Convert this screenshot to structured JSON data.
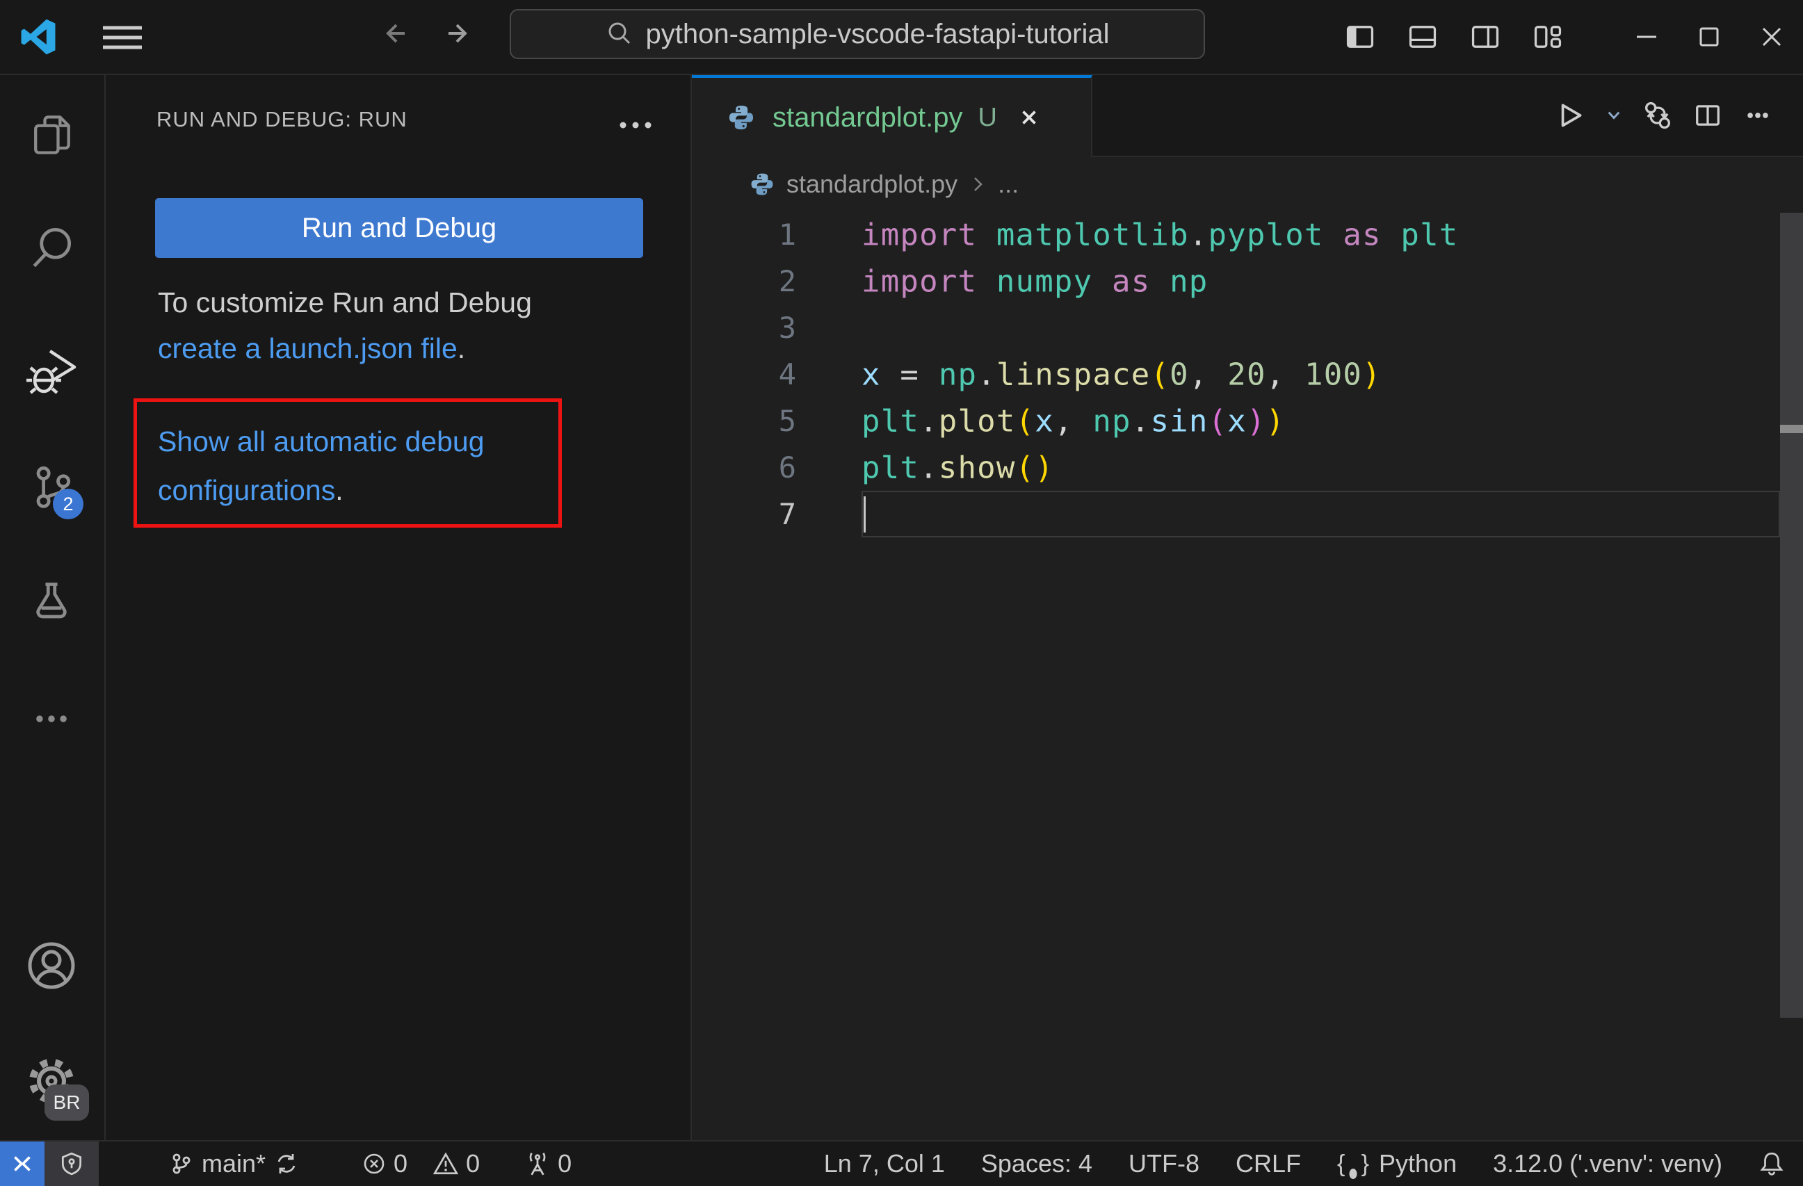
{
  "titlebar": {
    "command_center_text": "python-sample-vscode-fastapi-tutorial"
  },
  "activity_bar": {
    "source_control_badge": "2",
    "profile_badge": "BR"
  },
  "sidebar": {
    "title": "RUN AND DEBUG: RUN",
    "run_button_label": "Run and Debug",
    "hint_line": "To customize Run and Debug",
    "hint_link": "create a launch.json file",
    "hint_period": ".",
    "auto_config_link_line1": "Show all automatic debug",
    "auto_config_link_line2": "configurations",
    "auto_config_period": "."
  },
  "editor": {
    "tab": {
      "label": "standardplot.py",
      "git_status": "U"
    },
    "breadcrumb": {
      "file": "standardplot.py",
      "symbol": "..."
    },
    "code": {
      "active_line": 7,
      "lines": [
        [
          [
            "kw",
            "import"
          ],
          [
            "pl",
            " "
          ],
          [
            "mod",
            "matplotlib"
          ],
          [
            "pu",
            "."
          ],
          [
            "mod",
            "pyplot"
          ],
          [
            "pl",
            " "
          ],
          [
            "kw",
            "as"
          ],
          [
            "pl",
            " "
          ],
          [
            "mod",
            "plt"
          ]
        ],
        [
          [
            "kw",
            "import"
          ],
          [
            "pl",
            " "
          ],
          [
            "mod",
            "numpy"
          ],
          [
            "pl",
            " "
          ],
          [
            "kw",
            "as"
          ],
          [
            "pl",
            " "
          ],
          [
            "mod",
            "np"
          ]
        ],
        [],
        [
          [
            "var",
            "x"
          ],
          [
            "pl",
            " "
          ],
          [
            "pu",
            "="
          ],
          [
            "pl",
            " "
          ],
          [
            "mod",
            "np"
          ],
          [
            "pu",
            "."
          ],
          [
            "fn",
            "linspace"
          ],
          [
            "b1",
            "("
          ],
          [
            "num",
            "0"
          ],
          [
            "pu",
            ","
          ],
          [
            "pl",
            " "
          ],
          [
            "num",
            "20"
          ],
          [
            "pu",
            ","
          ],
          [
            "pl",
            " "
          ],
          [
            "num",
            "100"
          ],
          [
            "b1",
            ")"
          ]
        ],
        [
          [
            "mod",
            "plt"
          ],
          [
            "pu",
            "."
          ],
          [
            "fn",
            "plot"
          ],
          [
            "b1",
            "("
          ],
          [
            "var",
            "x"
          ],
          [
            "pu",
            ","
          ],
          [
            "pl",
            " "
          ],
          [
            "mod",
            "np"
          ],
          [
            "pu",
            "."
          ],
          [
            "var",
            "sin"
          ],
          [
            "b2",
            "("
          ],
          [
            "var",
            "x"
          ],
          [
            "b2",
            ")"
          ],
          [
            "b1",
            ")"
          ]
        ],
        [
          [
            "mod",
            "plt"
          ],
          [
            "pu",
            "."
          ],
          [
            "fn",
            "show"
          ],
          [
            "b1",
            "("
          ],
          [
            "b1",
            ")"
          ]
        ],
        []
      ]
    }
  },
  "status_bar": {
    "branch": "main*",
    "errors": "0",
    "warnings": "0",
    "ports": "0",
    "position": "Ln 7, Col 1",
    "indent": "Spaces: 4",
    "encoding": "UTF-8",
    "eol": "CRLF",
    "language": "Python",
    "interpreter": "3.12.0 ('.venv': venv)"
  },
  "colors": {
    "accent": "#0078d4",
    "button": "#3e79d0",
    "badge": "#3b76d2",
    "link": "#4d9cf2",
    "untracked_green": "#73c991",
    "highlight_border": "#ee1313"
  }
}
